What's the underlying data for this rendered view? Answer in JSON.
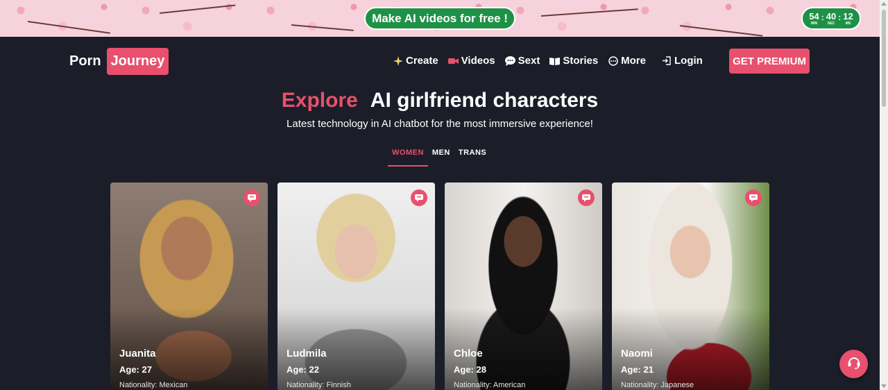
{
  "promo": {
    "cta_label": "Make AI videos for free !",
    "timer": {
      "minutes": "54",
      "minutes_label": "MIN",
      "seconds": "40",
      "seconds_label": "SEC",
      "ms": "12",
      "ms_label": "MS"
    },
    "colors": {
      "background": "#f6d3dc",
      "button": "#1f9147"
    }
  },
  "header": {
    "logo_part1": "Porn",
    "logo_part2": "Journey",
    "nav": [
      {
        "label": "Create",
        "icon": "sparkle-icon"
      },
      {
        "label": "Videos",
        "icon": "video-camera-icon"
      },
      {
        "label": "Sext",
        "icon": "chat-bubble-icon"
      },
      {
        "label": "Stories",
        "icon": "book-icon"
      },
      {
        "label": "More",
        "icon": "more-dots-icon"
      },
      {
        "label": "Login",
        "icon": "login-icon"
      }
    ],
    "premium_label": "GET PREMIUM"
  },
  "hero": {
    "title_accent": "Explore",
    "title_rest": "AI girlfriend characters",
    "subtitle": "Latest technology in AI chatbot for the most immersive experience!"
  },
  "tabs": [
    {
      "label": "WOMEN",
      "active": true
    },
    {
      "label": "MEN",
      "active": false
    },
    {
      "label": "TRANS",
      "active": false
    }
  ],
  "characters": [
    {
      "name": "Juanita",
      "age": "Age: 27",
      "nationality": "Nationality: Mexican"
    },
    {
      "name": "Ludmila",
      "age": "Age: 22",
      "nationality": "Nationality: Finnish"
    },
    {
      "name": "Chloe",
      "age": "Age: 28",
      "nationality": "Nationality: American"
    },
    {
      "name": "Naomi",
      "age": "Age: 21",
      "nationality": "Nationality: Japanese"
    }
  ],
  "colors": {
    "accent": "#e8506e",
    "page_background": "#1b1e29"
  }
}
